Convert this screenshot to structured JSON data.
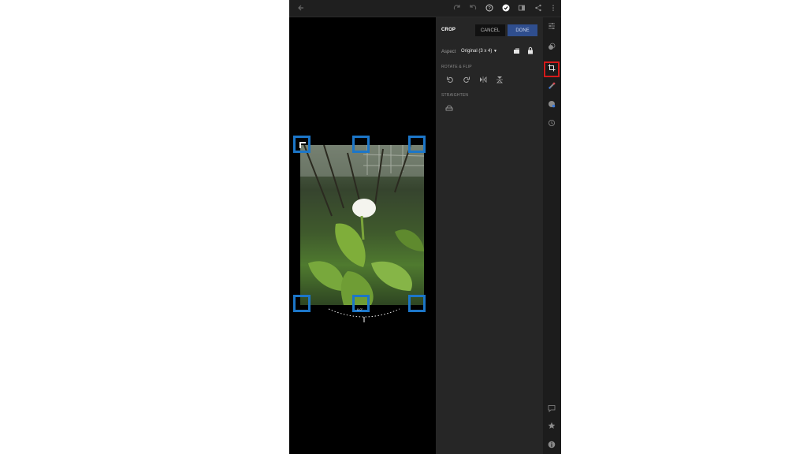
{
  "topbar": {
    "icons": [
      "back-arrow-icon",
      "redo-icon",
      "undo-icon",
      "help-icon",
      "done-check-icon",
      "compare-icon",
      "share-icon",
      "more-icon"
    ]
  },
  "panel": {
    "title": "CROP",
    "cancel_label": "CANCEL",
    "done_label": "DONE",
    "aspect_label": "Aspect",
    "aspect_value": "Original (3 x 4)",
    "rotate_flip_label": "ROTATE & FLIP",
    "straighten_label": "STRAIGHTEN"
  },
  "canvas": {
    "dial_value": "0.0°"
  },
  "rail": {
    "icons": [
      "edit-sliders-icon",
      "presets-icon",
      "crop-icon",
      "heal-icon",
      "masking-icon",
      "versions-icon",
      "comment-icon",
      "rating-star-icon",
      "info-icon"
    ],
    "active": "crop-icon"
  },
  "colors": {
    "accent": "#2f4e8e",
    "handle": "#1c76c8",
    "highlight": "#d41a1a"
  }
}
